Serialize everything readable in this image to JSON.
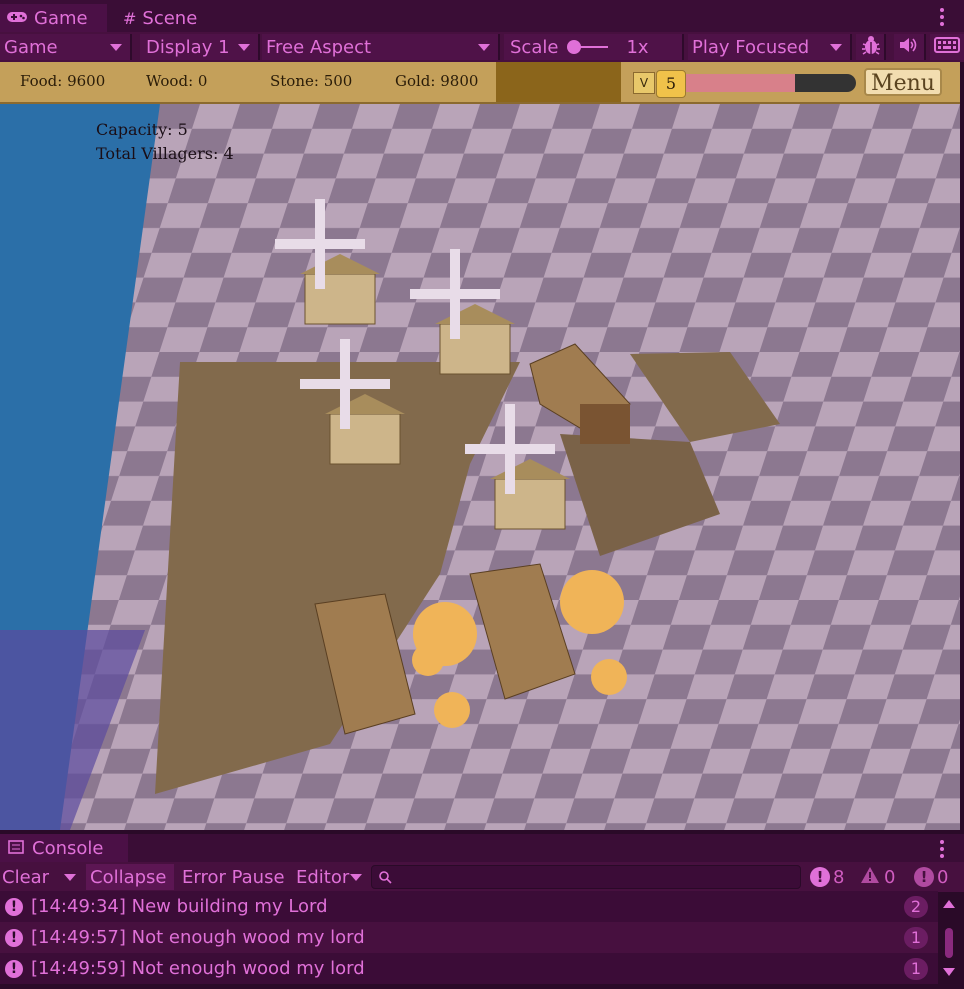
{
  "tabs": {
    "game": "Game",
    "scene": "Scene"
  },
  "toolbar": {
    "mode": "Game",
    "display": "Display 1",
    "aspect": "Free Aspect",
    "scale_label": "Scale",
    "scale_value": "1x",
    "play_mode": "Play Focused"
  },
  "hud": {
    "food": "Food: 9600",
    "wood": "Wood: 0",
    "stone": "Stone: 500",
    "gold": "Gold: 9800",
    "v_label": "V",
    "population": "5",
    "population_fill": 0.69,
    "menu": "Menu"
  },
  "stats": {
    "capacity": "Capacity: 5",
    "total_villagers": "Total Villagers: 4"
  },
  "console": {
    "title": "Console",
    "clear": "Clear",
    "collapse": "Collapse",
    "error_pause": "Error Pause",
    "editor": "Editor",
    "counts": {
      "errors": "8",
      "warnings": "0",
      "info": "0"
    },
    "logs": [
      {
        "text": "[14:49:34] New building my Lord",
        "count": "2"
      },
      {
        "text": "[14:49:57] Not enough wood my lord",
        "count": "1"
      },
      {
        "text": "[14:49:59] Not enough wood my lord",
        "count": "1"
      }
    ]
  },
  "colors": {
    "accent": "#e070d8",
    "hud_bg": "#c4a05a",
    "editor_bg": "#47103f"
  },
  "icons": [
    "gamepad-icon",
    "grid-icon",
    "bug-icon",
    "speaker-icon",
    "keyboard-icon",
    "console-icon",
    "search-icon",
    "error-icon",
    "warning-icon",
    "info-icon"
  ]
}
